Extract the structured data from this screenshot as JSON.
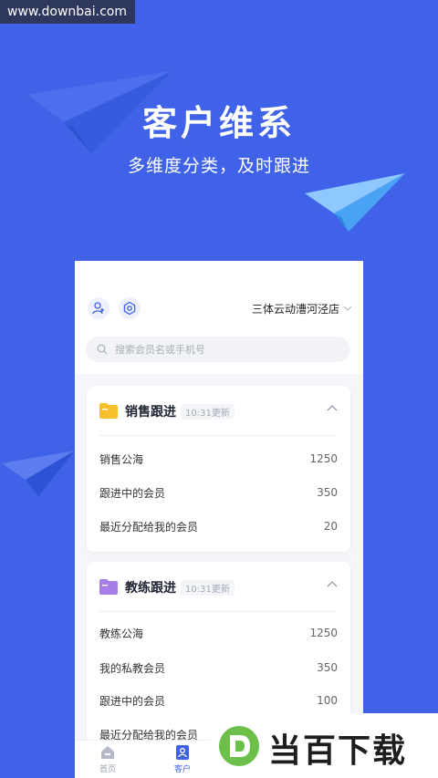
{
  "watermark": "www.downbai.com",
  "hero": {
    "title": "客户维系",
    "subtitle": "多维度分类，及时跟进"
  },
  "header": {
    "add_user_icon": "add-user-icon",
    "settings_icon": "settings-icon",
    "store_name": "三体云动漕河泾店",
    "store_chevron": "chevron-down-icon"
  },
  "search": {
    "placeholder": "搜索会员名或手机号"
  },
  "cards": [
    {
      "title": "销售跟进",
      "badge": "10:31更新",
      "folder_color": "#f6c02c",
      "rows": [
        {
          "label": "销售公海",
          "value": "1250"
        },
        {
          "label": "跟进中的会员",
          "value": "350"
        },
        {
          "label": "最近分配给我的会员",
          "value": "20"
        }
      ]
    },
    {
      "title": "教练跟进",
      "badge": "10:31更新",
      "folder_color": "#a77ee8",
      "rows": [
        {
          "label": "教练公海",
          "value": "1250"
        },
        {
          "label": "我的私教会员",
          "value": "350"
        },
        {
          "label": "跟进中的会员",
          "value": "100"
        },
        {
          "label": "最近分配给我的会员",
          "value": ""
        }
      ]
    }
  ],
  "tabbar": {
    "items": [
      {
        "label": "首页",
        "icon": "home-icon"
      },
      {
        "label": "客户",
        "icon": "customer-icon",
        "active": true
      },
      {
        "label": "",
        "icon": "chart-icon"
      },
      {
        "label": "",
        "icon": "profile-icon"
      }
    ]
  },
  "brand": {
    "logo": "D",
    "text": "当百下载"
  },
  "colors": {
    "background": "#3f62e8",
    "accent": "#3f62e8",
    "card": "#ffffff"
  }
}
